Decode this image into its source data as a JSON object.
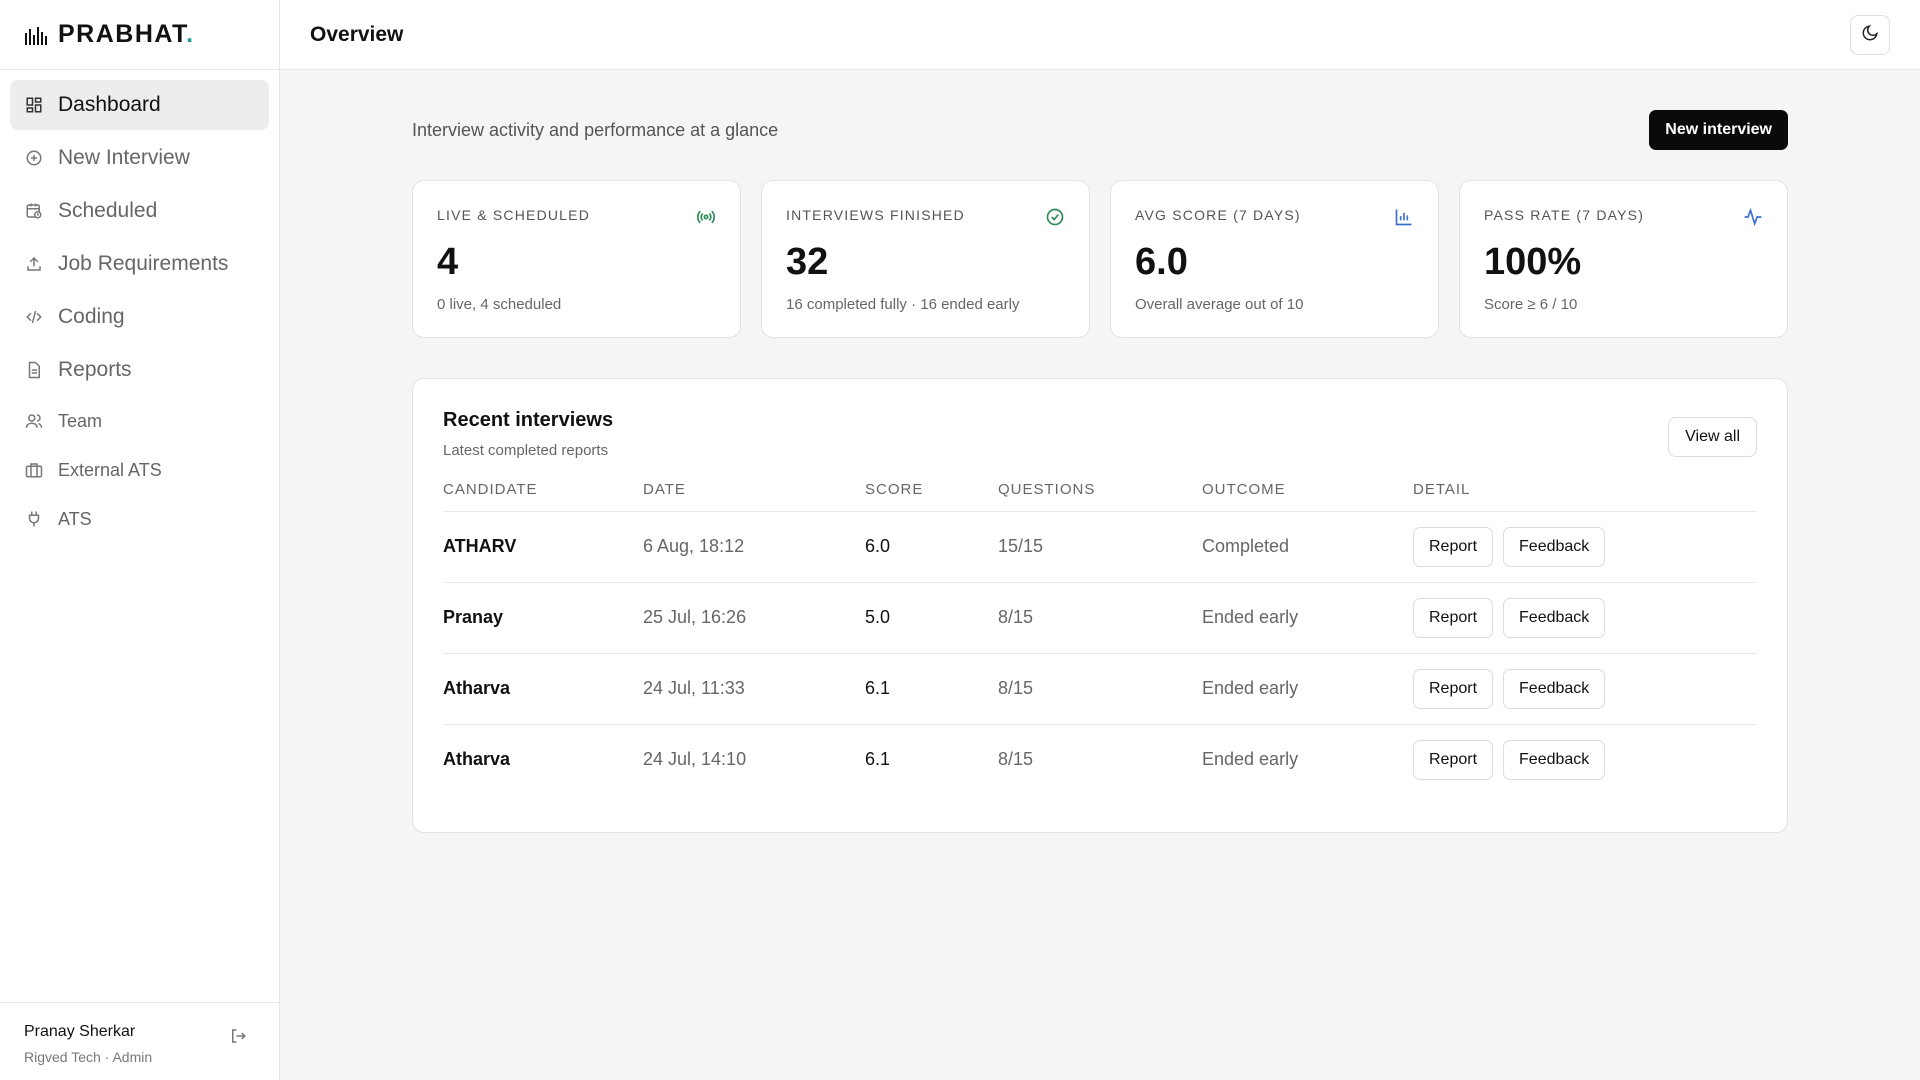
{
  "brand": {
    "name": "PRABHAT",
    "dot": ".",
    "accent": "#1f9d8f"
  },
  "sidebar": {
    "items": [
      {
        "label": "Dashboard",
        "icon": "grid-icon"
      },
      {
        "label": "New Interview",
        "icon": "plus-circle-icon"
      },
      {
        "label": "Scheduled",
        "icon": "calendar-clock-icon"
      },
      {
        "label": "Job Requirements",
        "icon": "upload-icon"
      },
      {
        "label": "Coding",
        "icon": "code-icon"
      },
      {
        "label": "Reports",
        "icon": "file-text-icon"
      },
      {
        "label": "Team",
        "icon": "users-icon"
      },
      {
        "label": "External ATS",
        "icon": "briefcase-icon"
      },
      {
        "label": "ATS",
        "icon": "plug-icon"
      }
    ]
  },
  "user": {
    "name": "Pranay Sherkar",
    "org": "Rigved Tech · Admin"
  },
  "header": {
    "title": "Overview"
  },
  "overview": {
    "subtitle": "Interview activity and performance at a glance",
    "new_interview_label": "New interview"
  },
  "stats": [
    {
      "label": "LIVE & SCHEDULED",
      "value": "4",
      "note": "0 live, 4 scheduled",
      "icon": "broadcast-icon",
      "icon_color": "#2e8b57"
    },
    {
      "label": "INTERVIEWS FINISHED",
      "value": "32",
      "note": "16 completed fully · 16 ended early",
      "icon": "check-circle-icon",
      "icon_color": "#2e8b57"
    },
    {
      "label": "AVG SCORE (7 DAYS)",
      "value": "6.0",
      "note": "Overall average out of 10",
      "icon": "bar-chart-icon",
      "icon_color": "#3b6fd1"
    },
    {
      "label": "PASS RATE (7 DAYS)",
      "value": "100%",
      "note": "Score ≥ 6 / 10",
      "icon": "activity-icon",
      "icon_color": "#3b6fd1"
    }
  ],
  "recent": {
    "title": "Recent interviews",
    "subtitle": "Latest completed reports",
    "view_all_label": "View all",
    "columns": [
      "CANDIDATE",
      "DATE",
      "SCORE",
      "QUESTIONS",
      "OUTCOME",
      "DETAIL"
    ],
    "report_label": "Report",
    "feedback_label": "Feedback",
    "rows": [
      {
        "candidate": "ATHARV",
        "date": "6 Aug, 18:12",
        "score": "6.0",
        "questions": "15/15",
        "outcome": "Completed"
      },
      {
        "candidate": "Pranay",
        "date": "25 Jul, 16:26",
        "score": "5.0",
        "questions": "8/15",
        "outcome": "Ended early"
      },
      {
        "candidate": "Atharva",
        "date": "24 Jul, 11:33",
        "score": "6.1",
        "questions": "8/15",
        "outcome": "Ended early"
      },
      {
        "candidate": "Atharva",
        "date": "24 Jul, 14:10",
        "score": "6.1",
        "questions": "8/15",
        "outcome": "Ended early"
      }
    ]
  }
}
